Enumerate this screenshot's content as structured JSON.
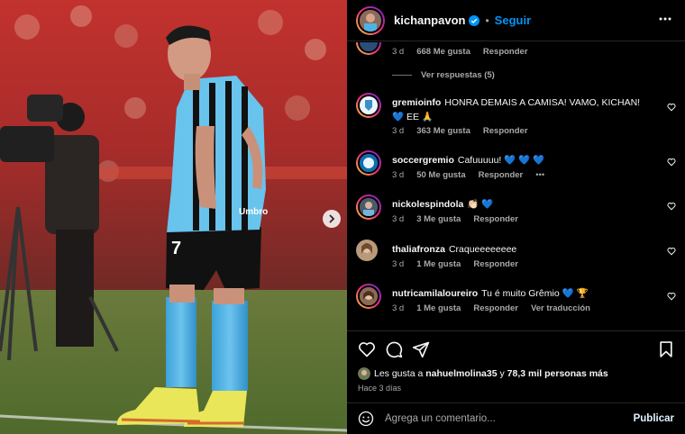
{
  "header": {
    "username": "kichanpavon",
    "follow_label": "Seguir",
    "separator": "•"
  },
  "colors": {
    "accent": "#0095f6",
    "background": "#000000",
    "muted": "#a8a8a8",
    "heart": "#3897f0"
  },
  "top_comment_meta": {
    "time": "3 d",
    "likes": "668 Me gusta",
    "reply": "Responder"
  },
  "view_replies": "Ver respuestas (5)",
  "comments": [
    {
      "user": "gremioinfo",
      "text": "HONRA DEMAIS A CAMISA! VAMO, KICHAN! 💙 EE 🙏",
      "time": "3 d",
      "likes": "363 Me gusta",
      "reply": "Responder"
    },
    {
      "user": "soccergremio",
      "text": "Cafuuuuu! 💙 💙 💙",
      "time": "3 d",
      "likes": "50 Me gusta",
      "reply": "Responder",
      "more": "•••"
    },
    {
      "user": "nickolespindola",
      "text": "👏🏻 💙",
      "time": "3 d",
      "likes": "3 Me gusta",
      "reply": "Responder"
    },
    {
      "user": "thaliafronza",
      "text": "Craqueeeeeeee",
      "time": "3 d",
      "likes": "1 Me gusta",
      "reply": "Responder"
    },
    {
      "user": "nutricamilaloureiro",
      "text": "Tu é muito Grêmio 💙 🏆",
      "time": "3 d",
      "likes": "1 Me gusta",
      "reply": "Responder",
      "translate": "Ver traducción"
    }
  ],
  "likes_summary": {
    "prefix": "Les gusta a",
    "user": "nahuelmolina35",
    "middle": "y",
    "count": "78,3 mil personas más"
  },
  "post_date": "Hace 3 días",
  "composer": {
    "placeholder": "Agrega un comentario...",
    "post_label": "Publicar"
  },
  "photo": {
    "jersey_number": "7",
    "sponsor": "Umbro"
  },
  "icons": [
    "ellipsis-icon",
    "verified-icon",
    "heart-icon",
    "comment-icon",
    "share-icon",
    "bookmark-icon",
    "emoji-icon",
    "chevron-right-icon"
  ]
}
